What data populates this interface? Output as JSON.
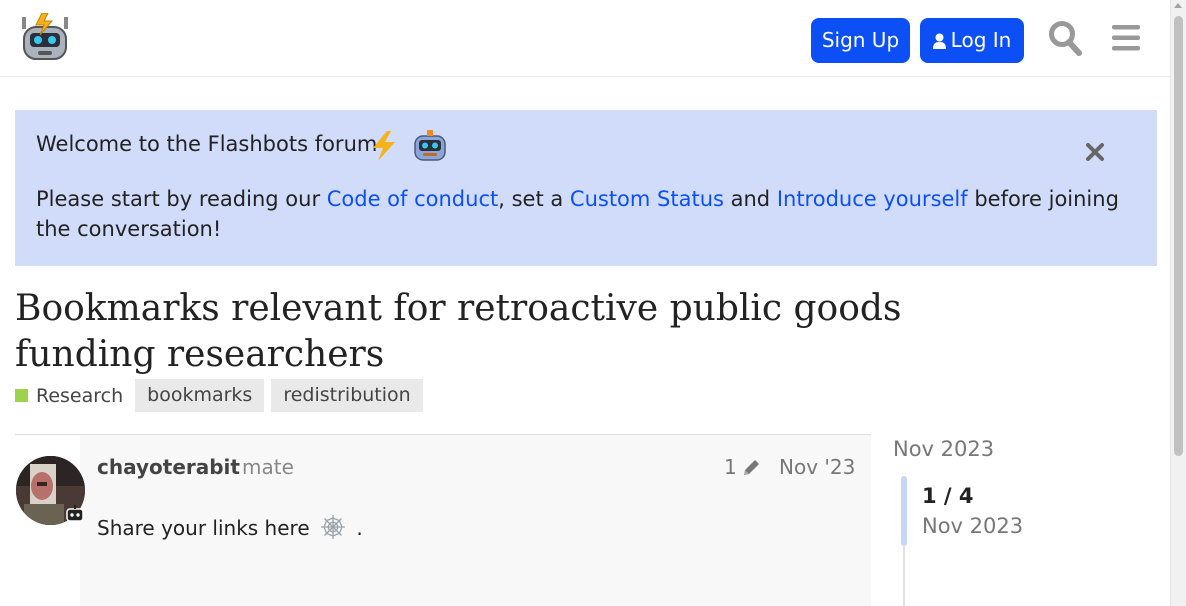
{
  "header": {
    "signup_label": "Sign Up",
    "login_label": "Log In",
    "icons": [
      "robot-logo",
      "user-icon",
      "search-icon",
      "menu-icon"
    ]
  },
  "banner": {
    "title": "Welcome to the Flashbots forum",
    "text_prefix": "Please start by reading our ",
    "link_conduct": "Code of conduct",
    "text_mid1": ", set a ",
    "link_status": "Custom Status",
    "text_mid2": " and ",
    "link_intro": "Introduce yourself",
    "text_suffix": " before joining the conversation!"
  },
  "topic": {
    "title": "Bookmarks relevant for retroactive public goods funding researchers",
    "category": "Research",
    "category_color": "#9dd34a",
    "tags": [
      "bookmarks",
      "redistribution"
    ]
  },
  "post": {
    "username": "chayoterabit",
    "user_title": "mate",
    "edit_count": "1",
    "date": "Nov '23",
    "body_text": "Share your links here",
    "body_end": "."
  },
  "timeline": {
    "start_date": "Nov 2023",
    "position": "1 / 4",
    "current_date": "Nov 2023"
  },
  "colors": {
    "accent": "#0b4ff5",
    "banner_bg": "#d1dcfb"
  }
}
